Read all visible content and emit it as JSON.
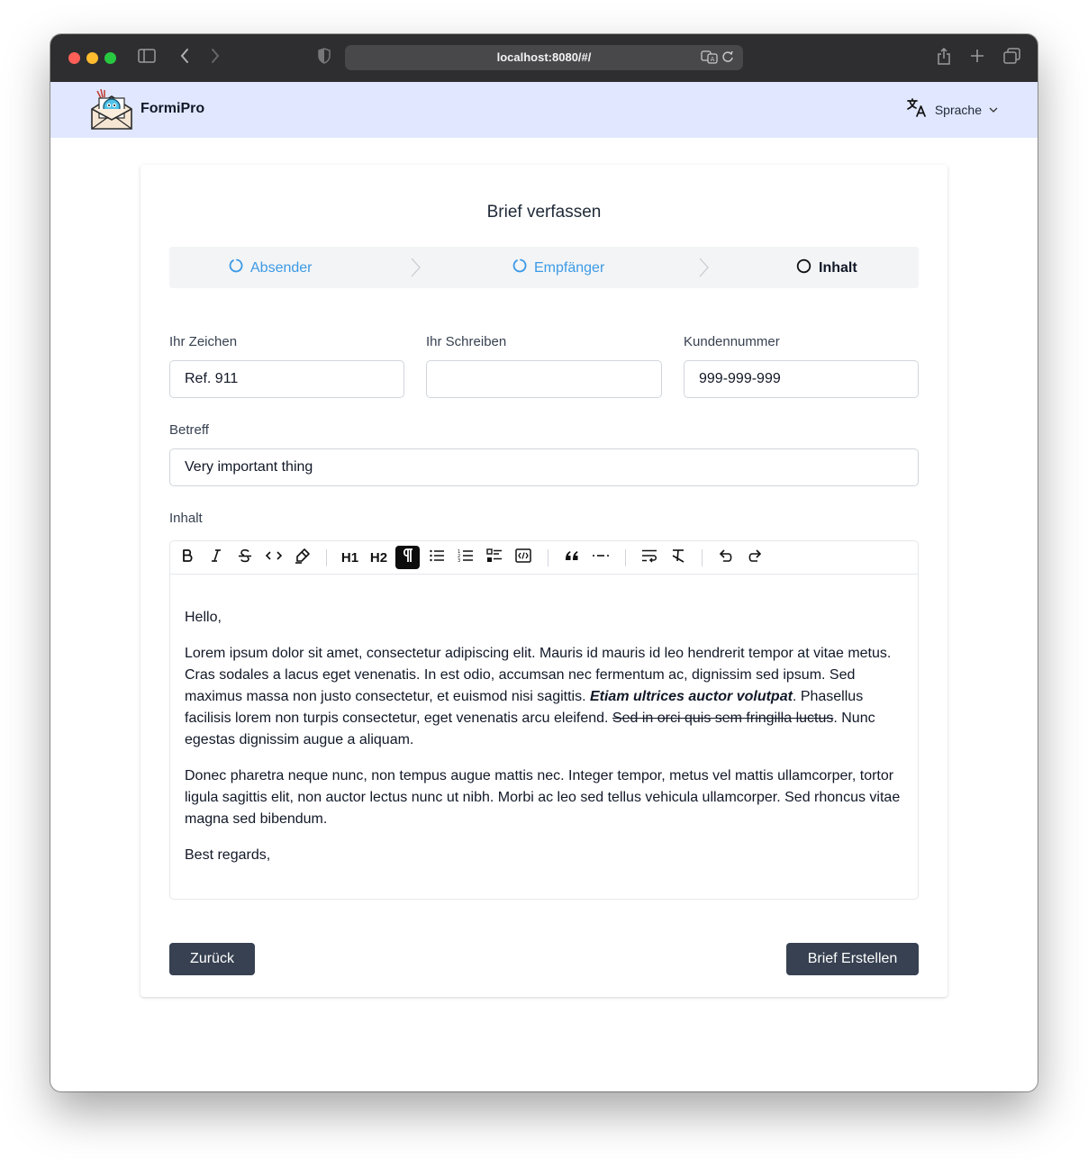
{
  "browser": {
    "url": "localhost:8080/#/"
  },
  "app": {
    "brand": "FormiPro",
    "language_label": "Sprache"
  },
  "form": {
    "title": "Brief verfassen",
    "steps": [
      {
        "label": "Absender",
        "state": "done"
      },
      {
        "label": "Empfänger",
        "state": "done"
      },
      {
        "label": "Inhalt",
        "state": "active"
      }
    ],
    "fields": {
      "ihr_zeichen": {
        "label": "Ihr Zeichen",
        "value": "Ref. 911"
      },
      "ihr_schreiben": {
        "label": "Ihr Schreiben",
        "value": ""
      },
      "kundennummer": {
        "label": "Kundennummer",
        "value": "999-999-999"
      },
      "betreff": {
        "label": "Betreff",
        "value": "Very important thing"
      }
    },
    "content_label": "Inhalt",
    "toolbar": {
      "h1": "H1",
      "h2": "H2"
    },
    "content": {
      "greeting": "Hello,",
      "p1_a": "Lorem ipsum dolor sit amet, consectetur adipiscing elit. Mauris id mauris id leo hendrerit tempor at vitae metus. Cras sodales a lacus eget venenatis. In est odio, accumsan nec fermentum ac, dignissim sed ipsum. Sed maximus massa non justo consectetur, et euismod nisi sagittis. ",
      "p1_bold_italic": "Etiam ultrices auctor volutpat",
      "p1_b": ". Phasellus facilisis lorem non turpis consectetur, eget venenatis arcu eleifend. ",
      "p1_strike": "Sed in orci quis sem fringilla luctus",
      "p1_c": ". Nunc egestas dignissim augue a aliquam.",
      "p2": "Donec pharetra neque nunc, non tempus augue mattis nec. Integer tempor, metus vel mattis ullamcorper, tortor ligula sagittis elit, non auctor lectus nunc ut nibh. Morbi ac leo sed tellus vehicula ullamcorper. Sed rhoncus vitae magna sed bibendum.",
      "closing": "Best regards,"
    },
    "back_button": "Zurück",
    "submit_button": "Brief Erstellen"
  },
  "colors": {
    "appbar_bg": "#e0e7ff",
    "step_done": "#3b9ae6",
    "button_bg": "#374151"
  }
}
